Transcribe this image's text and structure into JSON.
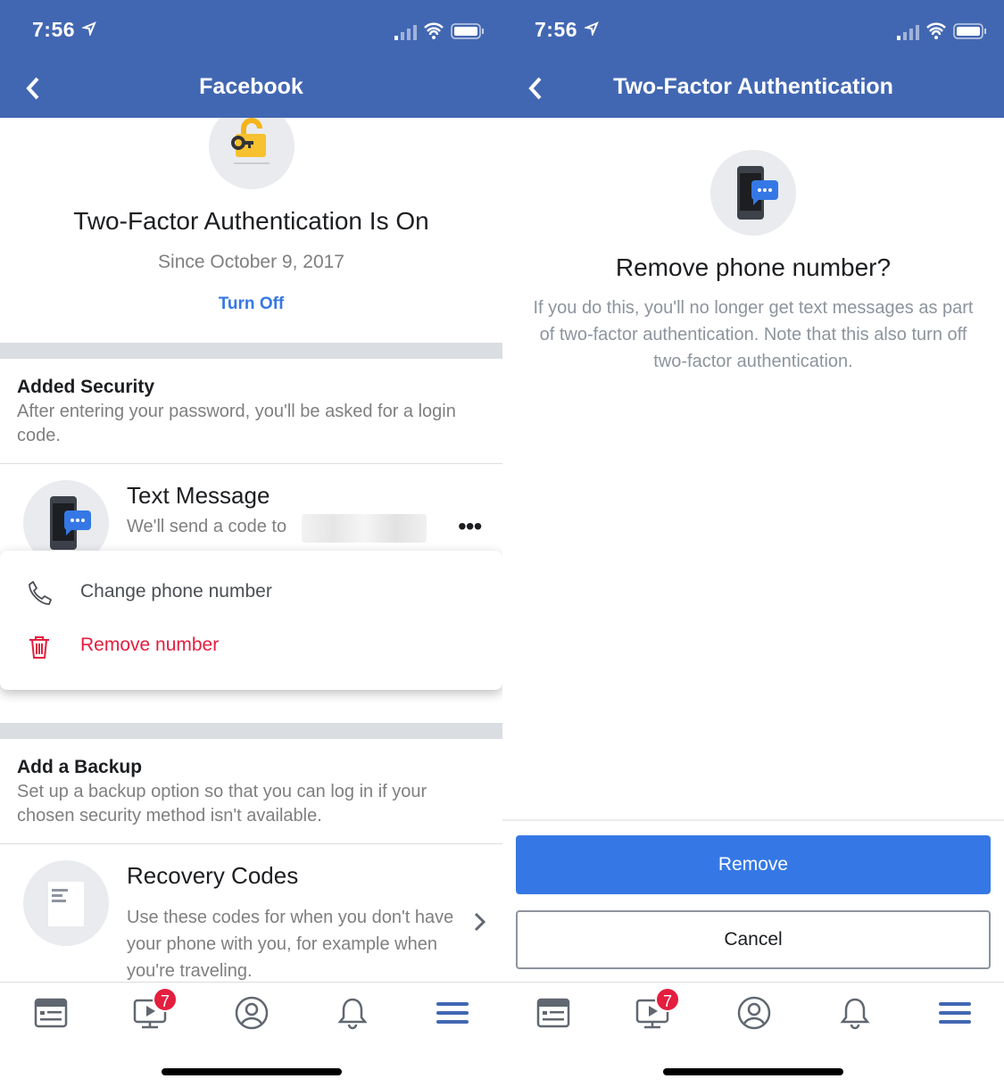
{
  "status": {
    "time": "7:56"
  },
  "left": {
    "header_title": "Facebook",
    "tfa_status": "Two-Factor Authentication Is On",
    "since": "Since October 9, 2017",
    "turn_off": "Turn Off",
    "added_security": {
      "title": "Added Security",
      "desc": "After entering your password, you'll be asked for a login code."
    },
    "text_message": {
      "title": "Text Message",
      "desc": "We'll send a code to"
    },
    "menu": {
      "change": "Change phone number",
      "remove": "Remove number"
    },
    "add_backup": {
      "title": "Add a Backup",
      "desc": "Set up a backup option so that you can log in if your chosen security method isn't available."
    },
    "recovery": {
      "title": "Recovery Codes",
      "desc": "Use these codes for when you don't have your phone with you, for example when you're traveling."
    }
  },
  "right": {
    "header_title": "Two-Factor Authentication",
    "dialog_title": "Remove phone number?",
    "dialog_desc": "If you do this, you'll no longer get text messages as part of two-factor authentication. Note that this also turn off two-factor authentication.",
    "remove_button": "Remove",
    "cancel_button": "Cancel"
  },
  "tabbar": {
    "watch_badge": "7"
  },
  "colors": {
    "brand": "#4267b2",
    "accent": "#3578e5",
    "danger": "#e41e3f"
  }
}
